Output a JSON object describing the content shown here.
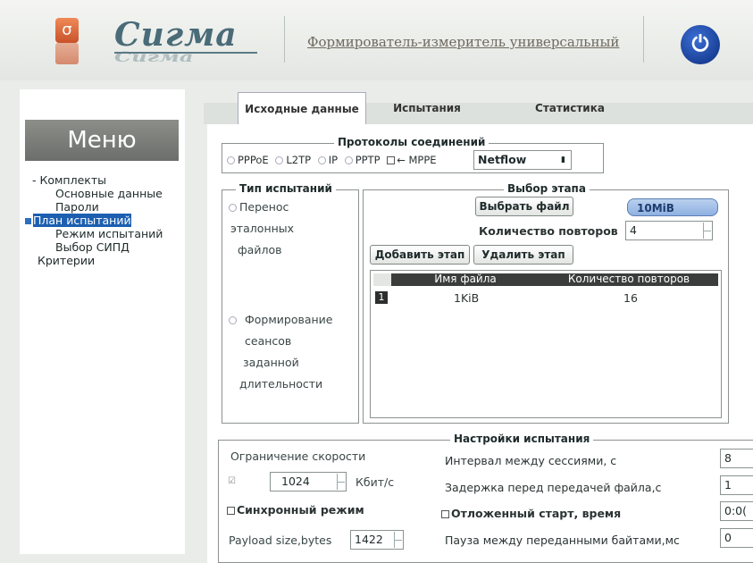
{
  "header": {
    "logo_text": "Сигма",
    "app_title": "Формирователь-измеритель универсальный"
  },
  "menu": {
    "title": "Меню",
    "items": [
      {
        "label": "Комплекты",
        "level": 1,
        "prefix": "-"
      },
      {
        "label": "Основные данные",
        "level": 2
      },
      {
        "label": "Пароли",
        "level": 2
      },
      {
        "label": "План испытаний",
        "level": 1,
        "selected": true
      },
      {
        "label": "Режим испытаний",
        "level": 2
      },
      {
        "label": "Выбор СИПД",
        "level": 2
      },
      {
        "label": "Критерии",
        "level": 1
      }
    ]
  },
  "tabs": [
    "Исходные данные",
    "Испытания",
    "Статистика"
  ],
  "protocols": {
    "legend": "Протоколы соединений",
    "options": [
      "PPPoE",
      "L2TP",
      "IP",
      "PPTP",
      "← MPPE"
    ],
    "select_value": "Netflow"
  },
  "test_type": {
    "legend": "Тип испытаний",
    "option1_lines": [
      "Перенос",
      "эталонных",
      "файлов"
    ],
    "option2_lines": [
      "Формирование",
      "сеансов",
      "заданной",
      "длительности"
    ]
  },
  "stage": {
    "legend": "Выбор этапа",
    "choose_file_label": "Выбрать файл",
    "file_value": "10MiB",
    "repeats_label": "Количество повторов",
    "repeats_value": "4",
    "add_label": "Добавить этап",
    "remove_label": "Удалить этап",
    "columns": [
      "Имя файла",
      "Количество повторов"
    ],
    "rows": [
      {
        "num": "1",
        "file": "1KiB",
        "repeats": "16"
      }
    ]
  },
  "settings": {
    "legend": "Настройки испытания",
    "speed_limit_label": "Ограничение скорости",
    "speed_value": "1024",
    "speed_unit": "Кбит/с",
    "sync_label": "Синхронный режим",
    "payload_label": "Payload size,bytes",
    "payload_value": "1422",
    "interval_label": "Интервал между сессиями, с",
    "interval_value": "8",
    "delay_label": "Задержка перед передачей файла,с",
    "delay_value": "1",
    "deferred_label": "Отложенный старт, время",
    "deferred_value": "0:0(",
    "pause_label": "Пауза между переданными байтами,мс",
    "pause_value": "0"
  }
}
